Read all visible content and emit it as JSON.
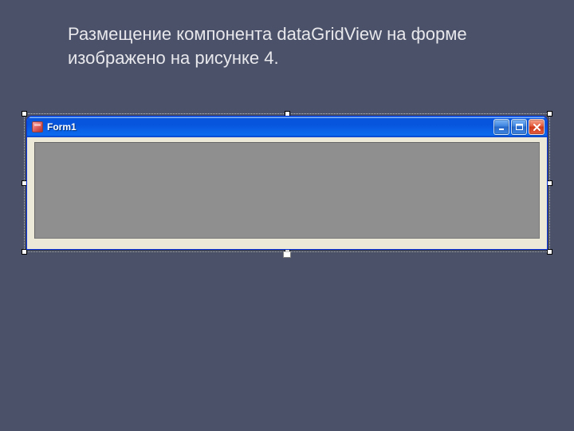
{
  "caption": "Размещение компонента dataGridView на форме изображено на рисунке 4.",
  "window": {
    "title": "Form1"
  }
}
